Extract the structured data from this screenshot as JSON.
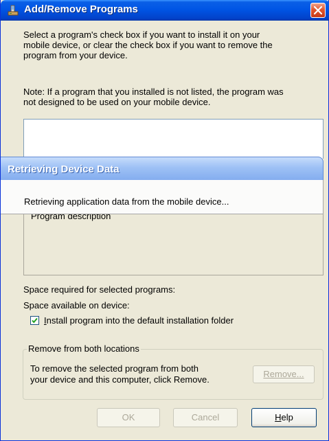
{
  "window": {
    "title": "Add/Remove Programs",
    "intro_line1": "Select a program's check box if you want to install it on your",
    "intro_line2": "mobile device, or clear the check box if you want to remove the",
    "intro_line3": "program from your device.",
    "note_line1": "Note:  If a program that you installed is not listed, the program was",
    "note_line2": "not designed to be used on your mobile device.",
    "description_label": "Program description",
    "space_required_label": "Space required for selected programs:",
    "space_available_label": "Space available on device:",
    "install_default_checkbox": {
      "label": "Install program into the default installation folder",
      "checked": true
    },
    "remove_group": {
      "legend": "Remove from both locations",
      "text_line1": "To remove the selected program from both",
      "text_line2": "your device and this computer, click Remove.",
      "remove_button": "Remove..."
    },
    "buttons": {
      "ok": "OK",
      "cancel": "Cancel",
      "help": "Help"
    }
  },
  "overlay": {
    "title": "Retrieving Device Data",
    "message": "Retrieving application data from the mobile device..."
  },
  "colors": {
    "title_bar": "#0055e5",
    "dialog_face": "#ece9d8",
    "overlay_header": "#9ec1f5",
    "close_button": "#e2562d"
  }
}
